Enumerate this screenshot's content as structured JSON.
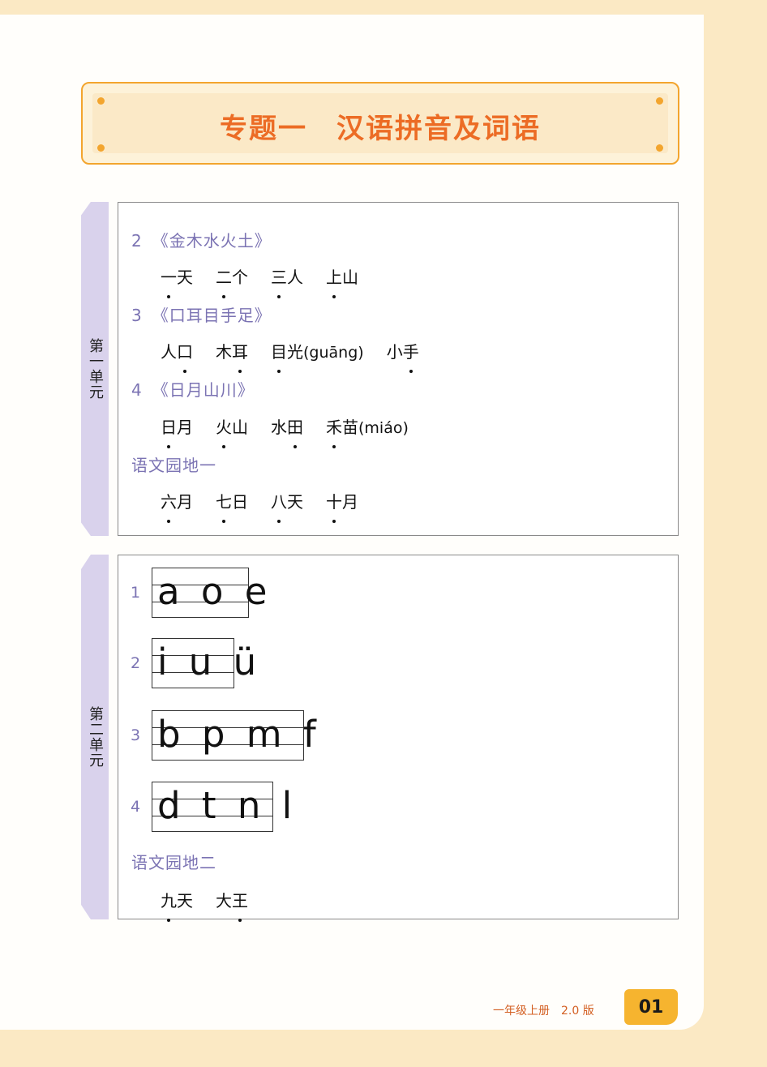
{
  "title": "专题一　汉语拼音及词语",
  "unit1": {
    "tab": "第一单元",
    "lessons": [
      {
        "num": "2",
        "name": "《金木水火土》"
      },
      {
        "num": "3",
        "name": "《口耳目手足》"
      },
      {
        "num": "4",
        "name": "《日月山川》"
      },
      {
        "num": "",
        "name": "语文园地一"
      }
    ],
    "word_rows": [
      [
        {
          "chars": [
            "一",
            "天"
          ],
          "dot": 0
        },
        {
          "chars": [
            "二",
            "个"
          ],
          "dot": 0
        },
        {
          "chars": [
            "三",
            "人"
          ],
          "dot": 0
        },
        {
          "chars": [
            "上",
            "山"
          ],
          "dot": 0
        }
      ],
      [
        {
          "chars": [
            "人",
            "口"
          ],
          "dot": 1
        },
        {
          "chars": [
            "木",
            "耳"
          ],
          "dot": 1
        },
        {
          "chars": [
            "目",
            "光"
          ],
          "dot": 0,
          "pinyin": "(guāng)"
        },
        {
          "chars": [
            "小",
            "手"
          ],
          "dot": 1
        }
      ],
      [
        {
          "chars": [
            "日",
            "月"
          ],
          "dot": 0
        },
        {
          "chars": [
            "火",
            "山"
          ],
          "dot": 0
        },
        {
          "chars": [
            "水",
            "田"
          ],
          "dot": 1
        },
        {
          "chars": [
            "禾",
            "苗"
          ],
          "dot": 0,
          "pinyin": "(miáo)"
        }
      ],
      [
        {
          "chars": [
            "六",
            "月"
          ],
          "dot": 0
        },
        {
          "chars": [
            "七",
            "日"
          ],
          "dot": 0
        },
        {
          "chars": [
            "八",
            "天"
          ],
          "dot": 0
        },
        {
          "chars": [
            "十",
            "月"
          ],
          "dot": 0
        }
      ]
    ]
  },
  "unit2": {
    "tab": "第二单元",
    "items": [
      {
        "num": "1",
        "letters": "a o e"
      },
      {
        "num": "2",
        "letters": "i u ü"
      },
      {
        "num": "3",
        "letters": "b p m f"
      },
      {
        "num": "4",
        "letters": "d t n l"
      }
    ],
    "garden": "语文园地二",
    "words": [
      {
        "chars": [
          "九",
          "天"
        ],
        "dot": 0
      },
      {
        "chars": [
          "大",
          "王"
        ],
        "dot": 1
      }
    ]
  },
  "footer": {
    "book": "一年级上册　2.0 版",
    "page": "01"
  },
  "colors": {
    "accent": "#ec6c25",
    "frame": "#f3a52e",
    "tab": "#d9d2ec",
    "lesson": "#7b73b3"
  }
}
